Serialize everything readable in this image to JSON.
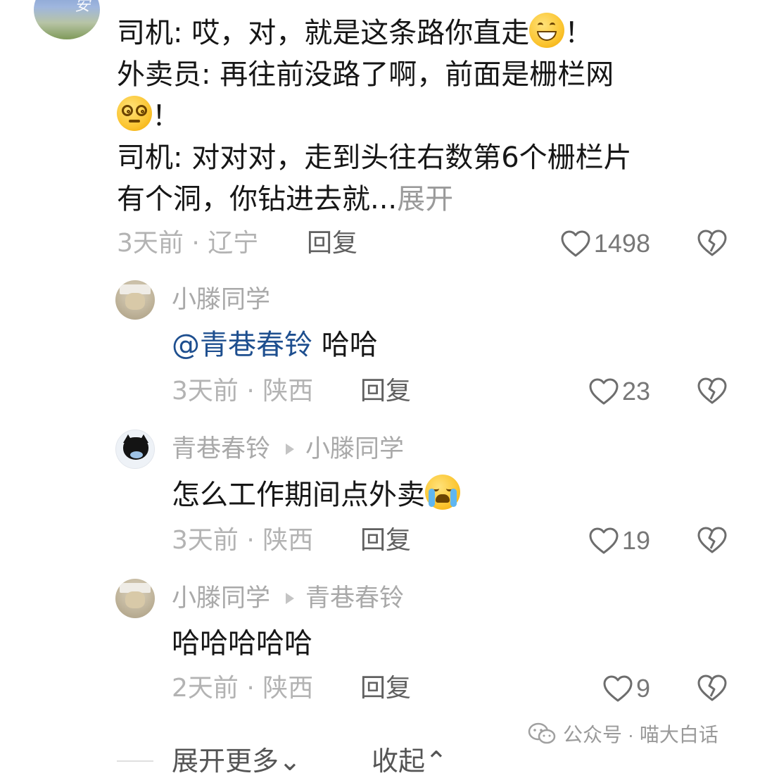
{
  "main_comment": {
    "lines": [
      "司机: 哎，对，就是这条路你直走",
      "！",
      "外卖员: 再往前没路了啊，前面是栅栏网",
      "！",
      "司机: 对对对，走到头往右数第6个栅栏片",
      "有个洞，你钻进去就..."
    ],
    "expand_label": "展开",
    "meta": "3天前 · 辽宁",
    "reply_label": "回复",
    "likes": "1498",
    "emojis": [
      "grin-emoji",
      "dizzy-emoji"
    ]
  },
  "replies": [
    {
      "user": "小滕同学",
      "reply_to": "",
      "mention": "@青巷春铃",
      "text": " 哈哈",
      "meta": "3天前 · 陕西",
      "reply_label": "回复",
      "likes": "23"
    },
    {
      "user": "青巷春铃",
      "reply_to": "小滕同学",
      "text": "怎么工作期间点外卖",
      "emoji": "crying-emoji",
      "meta": "3天前 · 陕西",
      "reply_label": "回复",
      "likes": "19"
    },
    {
      "user": "小滕同学",
      "reply_to": "青巷春铃",
      "text": "哈哈哈哈哈",
      "meta": "2天前 · 陕西",
      "reply_label": "回复",
      "likes": "9"
    }
  ],
  "footer": {
    "watermark": "公众号 · 喵大白话",
    "expand_more": "展开更多",
    "collapse": "收起"
  },
  "colors": {
    "mention": "#1e4f8f",
    "meta_gray": "#b3b3b3",
    "text": "#161616"
  }
}
